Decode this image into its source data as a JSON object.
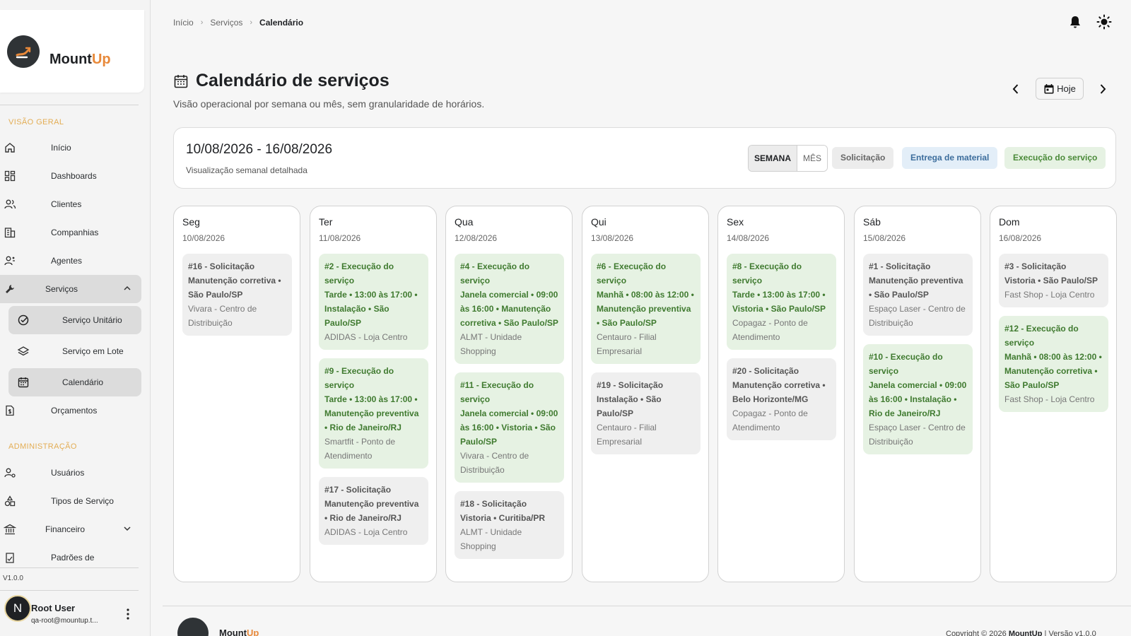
{
  "brand": {
    "name_main": "Mount",
    "name_accent": "Up",
    "accent_color": "#e8893a"
  },
  "sidebar": {
    "section_overview": "VISÃO GERAL",
    "section_admin": "ADMINISTRAÇÃO",
    "items": [
      {
        "label": "Início",
        "icon": "home-icon"
      },
      {
        "label": "Dashboards",
        "icon": "dashboard-icon"
      },
      {
        "label": "Clientes",
        "icon": "users-icon"
      },
      {
        "label": "Companhias",
        "icon": "building-icon"
      },
      {
        "label": "Agentes",
        "icon": "agent-icon"
      },
      {
        "label": "Serviços",
        "icon": "wrench-icon"
      }
    ],
    "service_sub": [
      {
        "label": "Serviço Unitário",
        "icon": "check-circle-icon"
      },
      {
        "label": "Serviço em Lote",
        "icon": "layers-icon"
      },
      {
        "label": "Calendário",
        "icon": "calendar-icon"
      }
    ],
    "budget": {
      "label": "Orçamentos",
      "icon": "document-dollar-icon"
    },
    "admin_items": [
      {
        "label": "Usuários",
        "icon": "user-gear-icon"
      },
      {
        "label": "Tipos de Serviço",
        "icon": "shapes-icon"
      },
      {
        "label": "Financeiro",
        "icon": "bank-icon"
      },
      {
        "label": "Padrões de",
        "icon": "pattern-icon"
      }
    ],
    "version": "V1.0.0",
    "user": {
      "initial": "N",
      "name": "Root User",
      "email": "qa-root@mountup.t..."
    }
  },
  "breadcrumb": {
    "home": "Início",
    "services": "Serviços",
    "current": "Calendário"
  },
  "page": {
    "title": "Calendário de serviços",
    "subtitle": "Visão operacional por semana ou mês, sem granularidade de horários.",
    "today_label": "Hoje"
  },
  "range": {
    "title": "10/08/2026 - 16/08/2026",
    "subtitle": "Visualização semanal detalhada",
    "view_week": "SEMANA",
    "view_month": "MÊS",
    "legend": [
      {
        "label": "Solicitação",
        "bg": "#ececec",
        "fg": "#666666"
      },
      {
        "label": "Entrega de material",
        "bg": "#e3eef8",
        "fg": "#3c6d9c"
      },
      {
        "label": "Execução do serviço",
        "bg": "#e6f2e3",
        "fg": "#4a8a38"
      }
    ]
  },
  "days": [
    {
      "name": "Seg",
      "date": "10/08/2026",
      "events": [
        {
          "kind": "req",
          "title": "#16 - Solicitação",
          "detail": "Manutenção corretiva • São Paulo/SP",
          "client": "Vivara - Centro de Distribuição"
        }
      ]
    },
    {
      "name": "Ter",
      "date": "11/08/2026",
      "events": [
        {
          "kind": "exec",
          "title": "#2 - Execução do serviço",
          "detail": "Tarde • 13:00 às 17:00 • Instalação • São Paulo/SP",
          "client": "ADIDAS - Loja Centro"
        },
        {
          "kind": "exec",
          "title": "#9 - Execução do serviço",
          "detail": "Tarde • 13:00 às 17:00 • Manutenção preventiva • Rio de Janeiro/RJ",
          "client": "Smartfit - Ponto de Atendimento"
        },
        {
          "kind": "req",
          "title": "#17 - Solicitação",
          "detail": "Manutenção preventiva • Rio de Janeiro/RJ",
          "client": "ADIDAS - Loja Centro"
        }
      ]
    },
    {
      "name": "Qua",
      "date": "12/08/2026",
      "events": [
        {
          "kind": "exec",
          "title": "#4 - Execução do serviço",
          "detail": "Janela comercial • 09:00 às 16:00 • Manutenção corretiva • São Paulo/SP",
          "client": "ALMT - Unidade Shopping"
        },
        {
          "kind": "exec",
          "title": "#11 - Execução do serviço",
          "detail": "Janela comercial • 09:00 às 16:00 • Vistoria • São Paulo/SP",
          "client": "Vivara - Centro de Distribuição"
        },
        {
          "kind": "req",
          "title": "#18 - Solicitação",
          "detail": "Vistoria • Curitiba/PR",
          "client": "ALMT - Unidade Shopping"
        }
      ]
    },
    {
      "name": "Qui",
      "date": "13/08/2026",
      "events": [
        {
          "kind": "exec",
          "title": "#6 - Execução do serviço",
          "detail": "Manhã • 08:00 às 12:00 • Manutenção preventiva • São Paulo/SP",
          "client": "Centauro - Filial Empresarial"
        },
        {
          "kind": "req",
          "title": "#19 - Solicitação",
          "detail": "Instalação • São Paulo/SP",
          "client": "Centauro - Filial Empresarial"
        }
      ]
    },
    {
      "name": "Sex",
      "date": "14/08/2026",
      "events": [
        {
          "kind": "exec",
          "title": "#8 - Execução do serviço",
          "detail": "Tarde • 13:00 às 17:00 • Vistoria • São Paulo/SP",
          "client": "Copagaz - Ponto de Atendimento"
        },
        {
          "kind": "req",
          "title": "#20 - Solicitação",
          "detail": "Manutenção corretiva • Belo Horizonte/MG",
          "client": "Copagaz - Ponto de Atendimento"
        }
      ]
    },
    {
      "name": "Sáb",
      "date": "15/08/2026",
      "events": [
        {
          "kind": "req",
          "title": "#1 - Solicitação",
          "detail": "Manutenção preventiva • São Paulo/SP",
          "client": "Espaço Laser - Centro de Distribuição"
        },
        {
          "kind": "exec",
          "title": "#10 - Execução do serviço",
          "detail": "Janela comercial • 09:00 às 16:00 • Instalação • Rio de Janeiro/RJ",
          "client": "Espaço Laser - Centro de Distribuição"
        }
      ]
    },
    {
      "name": "Dom",
      "date": "16/08/2026",
      "events": [
        {
          "kind": "req",
          "title": "#3 - Solicitação",
          "detail": "Vistoria • São Paulo/SP",
          "client": "Fast Shop - Loja Centro"
        },
        {
          "kind": "exec",
          "title": "#12 - Execução do serviço",
          "detail": "Manhã • 08:00 às 12:00 • Manutenção corretiva • São Paulo/SP",
          "client": "Fast Shop - Loja Centro"
        }
      ]
    }
  ],
  "footer": {
    "copyright": "Copyright © 2026",
    "brand": "MountUp",
    "version_text": "| Versão v1.0.0"
  }
}
